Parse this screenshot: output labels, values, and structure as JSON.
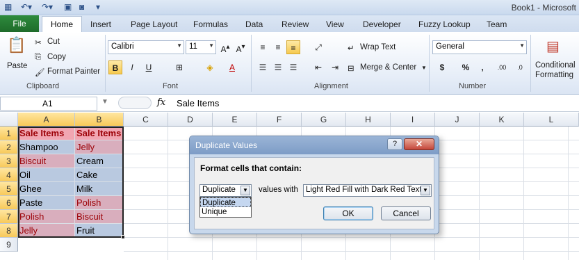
{
  "window": {
    "title": "Book1 - Microsoft"
  },
  "ribbon_tabs": [
    "File",
    "Home",
    "Insert",
    "Page Layout",
    "Formulas",
    "Data",
    "Review",
    "View",
    "Developer",
    "Fuzzy Lookup",
    "Team"
  ],
  "clipboard": {
    "paste": "Paste",
    "cut": "Cut",
    "copy": "Copy",
    "format_painter": "Format Painter",
    "group": "Clipboard"
  },
  "font": {
    "name": "Calibri",
    "size": "11",
    "group": "Font",
    "bold": "B",
    "italic": "I",
    "underline": "U"
  },
  "alignment": {
    "wrap_text": "Wrap Text",
    "merge_center": "Merge & Center",
    "group": "Alignment"
  },
  "number": {
    "format": "General",
    "group": "Number",
    "currency": "$",
    "percent": "%",
    "comma": ","
  },
  "styles": {
    "conditional_line1": "Conditional",
    "conditional_line2": "Formatting"
  },
  "formula_bar": {
    "name_box": "A1",
    "fx": "fx",
    "content": "Sale Items"
  },
  "sheet": {
    "columns": [
      "A",
      "B",
      "C",
      "D",
      "E",
      "F",
      "G",
      "H",
      "I",
      "J",
      "K",
      "L"
    ],
    "rows": [
      "1",
      "2",
      "3",
      "4",
      "5",
      "6",
      "7",
      "8",
      "9"
    ],
    "col_a": [
      "Sale Items",
      "Shampoo",
      "Biscuit",
      "Oil",
      "Ghee",
      "Paste",
      "Polish",
      "Jelly"
    ],
    "col_b": [
      "Sale Items",
      "Jelly",
      "Cream",
      "Cake",
      "Milk",
      "Polish",
      "Biscuit",
      "Fruit"
    ]
  },
  "dialog": {
    "title": "Duplicate Values",
    "help": "?",
    "close": "✕",
    "heading": "Format cells that contain:",
    "type_value": "Duplicate",
    "values_with": "values with",
    "format_value": "Light Red Fill with Dark Red Text",
    "options": [
      "Duplicate",
      "Unique"
    ],
    "ok": "OK",
    "cancel": "Cancel"
  },
  "colors": {
    "dup_fill": "#d9aebd",
    "dup_text": "#9c0006",
    "selection": "#b9c9e0",
    "accent": "#1e6b2a"
  }
}
